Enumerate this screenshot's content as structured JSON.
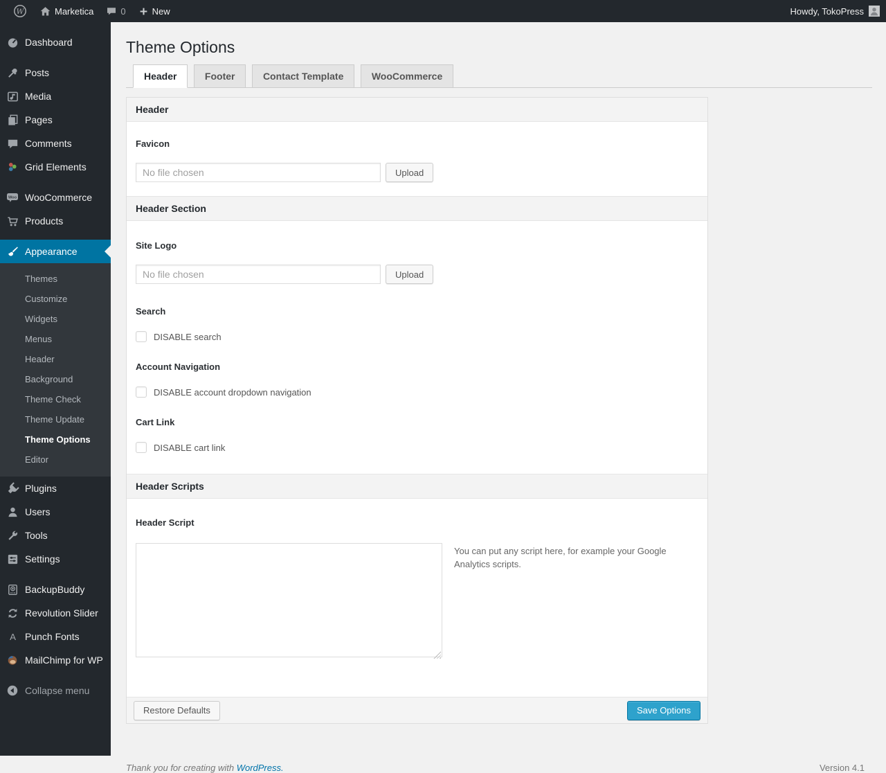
{
  "admin_bar": {
    "site_name": "Marketica",
    "comments_count": "0",
    "new_label": "New",
    "howdy": "Howdy, TokoPress"
  },
  "sidebar": {
    "items": [
      {
        "label": "Dashboard",
        "icon": "dashboard-icon"
      },
      {
        "label": "Posts",
        "icon": "pushpin-icon"
      },
      {
        "label": "Media",
        "icon": "media-icon"
      },
      {
        "label": "Pages",
        "icon": "pages-icon"
      },
      {
        "label": "Comments",
        "icon": "comments-icon"
      },
      {
        "label": "Grid Elements",
        "icon": "grid-elements-icon"
      },
      {
        "label": "WooCommerce",
        "icon": "woocommerce-icon"
      },
      {
        "label": "Products",
        "icon": "cart-icon"
      },
      {
        "label": "Appearance",
        "icon": "brush-icon",
        "active": true
      },
      {
        "label": "Plugins",
        "icon": "plugin-icon"
      },
      {
        "label": "Users",
        "icon": "user-icon"
      },
      {
        "label": "Tools",
        "icon": "wrench-icon"
      },
      {
        "label": "Settings",
        "icon": "settings-icon"
      },
      {
        "label": "BackupBuddy",
        "icon": "backup-icon"
      },
      {
        "label": "Revolution Slider",
        "icon": "rotate-icon"
      },
      {
        "label": "Punch Fonts",
        "icon": "letter-a-icon"
      },
      {
        "label": "MailChimp for WP",
        "icon": "mailchimp-icon"
      },
      {
        "label": "Collapse menu",
        "icon": "collapse-icon"
      }
    ],
    "appearance_submenu": [
      "Themes",
      "Customize",
      "Widgets",
      "Menus",
      "Header",
      "Background",
      "Theme Check",
      "Theme Update",
      "Theme Options",
      "Editor"
    ],
    "current_submenu_item": "Theme Options"
  },
  "page": {
    "title": "Theme Options",
    "tabs": [
      {
        "label": "Header",
        "active": true
      },
      {
        "label": "Footer",
        "active": false
      },
      {
        "label": "Contact Template",
        "active": false
      },
      {
        "label": "WooCommerce",
        "active": false
      }
    ]
  },
  "form": {
    "section_header_title": "Header",
    "favicon_label": "Favicon",
    "file_placeholder": "No file chosen",
    "upload_label": "Upload",
    "header_section_title": "Header Section",
    "site_logo_label": "Site Logo",
    "search_label": "Search",
    "disable_search_label": "DISABLE search",
    "account_nav_label": "Account Navigation",
    "disable_account_label": "DISABLE account dropdown navigation",
    "cart_link_label": "Cart Link",
    "disable_cart_label": "DISABLE cart link",
    "header_scripts_title": "Header Scripts",
    "header_script_label": "Header Script",
    "script_help": "You can put any script here, for example your Google Analytics scripts.",
    "restore_defaults_label": "Restore Defaults",
    "save_options_label": "Save Options"
  },
  "footer": {
    "thank_you_prefix": "Thank you for creating with ",
    "wordpress_link": "WordPress.",
    "version": "Version 4.1"
  },
  "colors": {
    "accent": "#0074a2",
    "primary_button": "#2ea2cc",
    "sidebar_bg": "#23282d"
  }
}
